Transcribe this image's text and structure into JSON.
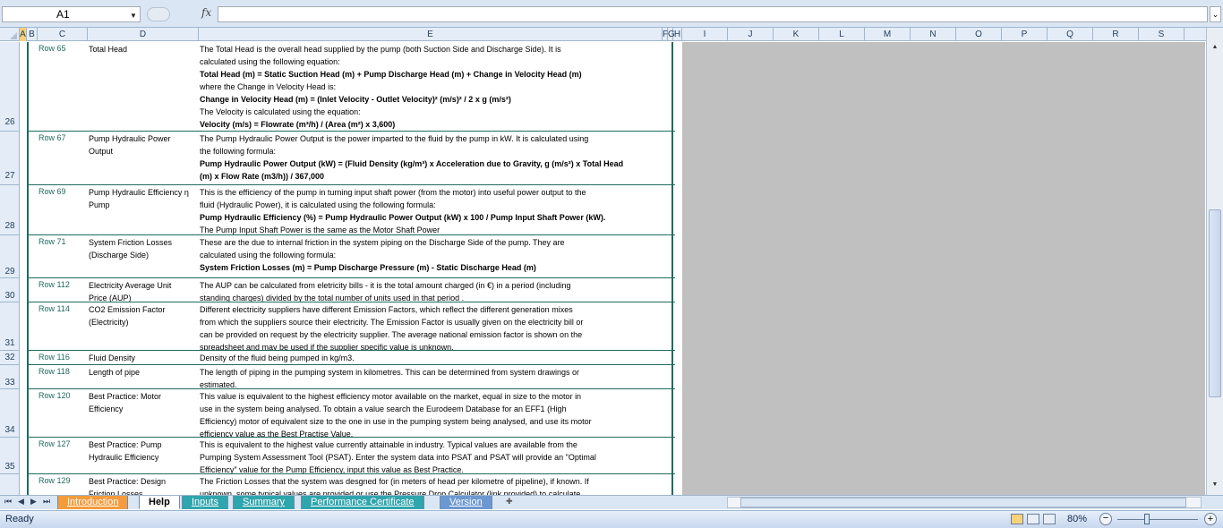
{
  "formula_bar": {
    "name_box": "A1",
    "fx_label": "fx",
    "formula": ""
  },
  "columns": [
    "A",
    "B",
    "C",
    "D",
    "E",
    "F",
    "G",
    "H",
    "I",
    "J",
    "K",
    "L",
    "M",
    "N",
    "O",
    "P",
    "Q",
    "R",
    "S"
  ],
  "rows": [
    {
      "num": "26",
      "c": "Row 65",
      "d": "Total Head",
      "e": [
        {
          "t": "The Total Head is the overall head supplied by the pump (both Suction Side and Discharge Side).  It is",
          "b": false
        },
        {
          "t": "calculated using the following equation:",
          "b": false
        },
        {
          "t": "Total Head (m) = Static Suction Head (m) + Pump Discharge Head (m) + Change in Velocity Head (m)",
          "b": true
        },
        {
          "t": "where the Change in Velocity Head is:",
          "b": false
        },
        {
          "t": "Change in Velocity Head (m)  = (Inlet Velocity - Outlet Velocity)² (m/s)² / 2 x g (m/s²)",
          "b": true
        },
        {
          "t": "The Velocity is calculated using the equation:",
          "b": false
        },
        {
          "t": "Velocity (m/s) = Flowrate (m³/h) / (Area (m²) x 3,600)",
          "b": true
        }
      ]
    },
    {
      "num": "27",
      "c": "Row 67",
      "d": "Pump Hydraulic Power Output",
      "e": [
        {
          "t": "The Pump Hydraulic Power Output is the power imparted to the fluid by the pump in kW.  It is calculated using",
          "b": false
        },
        {
          "t": "the following formula:",
          "b": false
        },
        {
          "t": "Pump Hydraulic Power Output (kW) = (Fluid Density (kg/m³) x Acceleration due to Gravity, g (m/s²) x Total Head",
          "b": true
        },
        {
          "t": "(m) x Flow Rate (m3/h)) / 367,000",
          "b": true
        }
      ]
    },
    {
      "num": "28",
      "c": "Row 69",
      "d": "Pump Hydraulic Efficiency η Pump",
      "e": [
        {
          "t": "This is the efficiency of the pump in turning input shaft power (from the motor) into useful power output to the",
          "b": false
        },
        {
          "t": "fluid (Hydraulic Power), it is calculated using the following formula:",
          "b": false
        },
        {
          "t": "Pump Hydraulic Efficiency (%) = Pump Hydraulic Power Output (kW) x 100 / Pump Input Shaft Power (kW).",
          "b": true
        },
        {
          "t": "The Pump Input Shaft Power is the same as the Motor Shaft Power",
          "b": false
        }
      ]
    },
    {
      "num": "29",
      "c": "Row 71",
      "d": "System Friction Losses (Discharge Side)",
      "e": [
        {
          "t": "These are the due to internal friction in the system piping on the  Discharge Side  of the pump.  They are",
          "b": false
        },
        {
          "t": "calculated using the following formula:",
          "b": false
        },
        {
          "t": "System Friction Losses (m) = Pump Discharge Pressure (m) - Static Discharge Head (m)",
          "b": true
        }
      ]
    },
    {
      "num": "30",
      "c": "Row 112",
      "d": "Electricity Average Unit Price (AUP)",
      "e": [
        {
          "t": "The AUP can be calculated from eletricity bills - it is the total amount charged (in €) in a period (including",
          "b": false
        },
        {
          "t": "standing charges) divided by the total number of units used in that period .",
          "b": false
        }
      ]
    },
    {
      "num": "31",
      "c": "Row 114",
      "d": "CO2 Emission Factor (Electricity)",
      "e": [
        {
          "t": "Different electricity suppliers have different Emission Factors, which reflect the different generation mixes",
          "b": false
        },
        {
          "t": "from which the suppliers source their electricity.  The Emission Factor is usually given on the electricity bill or",
          "b": false
        },
        {
          "t": "can be provided on request by the electricity supplier.  The average national emission factor is shown on the",
          "b": false
        },
        {
          "t": "spreadsheet and may be used if the supplier specific value is unknown.",
          "b": false
        }
      ]
    },
    {
      "num": "32",
      "c": "Row 116",
      "d": "Fluid Density",
      "e": [
        {
          "t": "Density of the fluid being pumped in kg/m3.",
          "b": false
        }
      ]
    },
    {
      "num": "33",
      "c": "Row 118",
      "d": "Length of pipe",
      "e": [
        {
          "t": "The length of piping in the pumping system in kilometres.  This can be determined from system drawings or",
          "b": false
        },
        {
          "t": "estimated.",
          "b": false
        }
      ]
    },
    {
      "num": "34",
      "c": "Row 120",
      "d": "Best Practice: Motor Efficiency",
      "e": [
        {
          "t": "This value is equivalent to the highest efficiency motor available on the market, equal in size to the motor in",
          "b": false
        },
        {
          "t": "use in the system being analysed.  To obtain a value search the Eurodeem Database for an EFF1 (High",
          "b": false
        },
        {
          "t": "Efficiency) motor of equivalent size to the one in use in the pumping system being analysed, and use its motor",
          "b": false
        },
        {
          "t": "efficiency value as the Best Practise Value.",
          "b": false
        }
      ]
    },
    {
      "num": "35",
      "c": "Row 127",
      "d": "Best Practice: Pump Hydraulic Efficiency",
      "e": [
        {
          "t": "This is equivalent to the highest value currently attainable in industry.  Typical values are available from the",
          "b": false
        },
        {
          "t": "Pumping System Assessment Tool (PSAT).  Enter the system data into PSAT and PSAT will provide an \"Optimal",
          "b": false
        },
        {
          "t": "Efficiency\" value for the Pump Efficiency, input this value as Best Practice.",
          "b": false
        }
      ]
    },
    {
      "num": "",
      "c": "Row 129",
      "d": "Best Practice: Design Friction Losses",
      "e": [
        {
          "t": "The Friction Losses that the system was desgned for (in meters of head per kilometre of pipeline), if known.  If",
          "b": false
        },
        {
          "t": "unknown, some typical values are provided or use the Pressure Drop Calculator (link provided) to calculate",
          "b": false
        }
      ]
    }
  ],
  "tabs": [
    "Introduction",
    "Help",
    "Inputs",
    "Summary",
    "Performance Certificate",
    "Version"
  ],
  "status": {
    "ready": "Ready",
    "zoom": "80%",
    "minus": "−",
    "plus": "+"
  },
  "icons": [
    "dropdown-arrow-icon",
    "fx-icon",
    "first-sheet-icon",
    "prev-sheet-icon",
    "next-sheet-icon",
    "last-sheet-icon",
    "new-sheet-icon",
    "scroll-up-icon",
    "scroll-down-icon"
  ]
}
